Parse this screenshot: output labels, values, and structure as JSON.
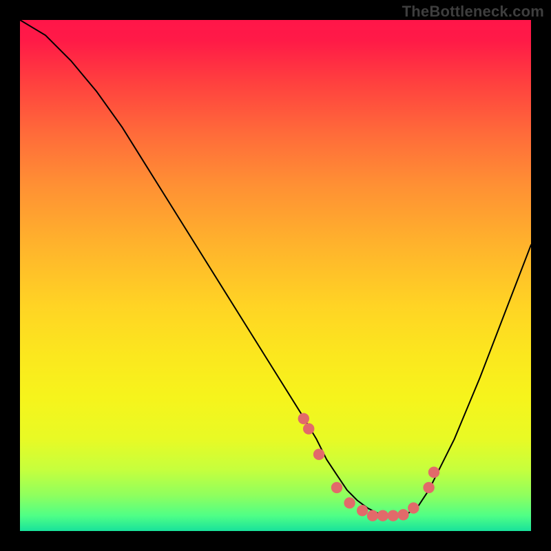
{
  "watermark": "TheBottleneck.com",
  "chart_data": {
    "type": "line",
    "title": "",
    "xlabel": "",
    "ylabel": "",
    "xlim": [
      0,
      100
    ],
    "ylim": [
      0,
      100
    ],
    "grid": false,
    "series": [
      {
        "name": "bottleneck-curve",
        "x": [
          0,
          5,
          10,
          15,
          20,
          25,
          30,
          35,
          40,
          45,
          50,
          55,
          58,
          60,
          62,
          64,
          66,
          68,
          70,
          72,
          74,
          76,
          78,
          80,
          85,
          90,
          95,
          100
        ],
        "y": [
          100,
          97,
          92,
          86,
          79,
          71,
          63,
          55,
          47,
          39,
          31,
          23,
          18,
          14,
          11,
          8,
          6,
          4.5,
          3.5,
          3,
          3,
          3.5,
          5,
          8,
          18,
          30,
          43,
          56
        ]
      }
    ],
    "markers": {
      "name": "highlight-dots",
      "color": "#e26a6a",
      "radius_pct": 1.1,
      "x": [
        55.5,
        56.5,
        58.5,
        62,
        64.5,
        67,
        69,
        71,
        73,
        75,
        77,
        80,
        81
      ],
      "y": [
        22,
        20,
        15,
        8.5,
        5.5,
        4,
        3,
        3,
        3,
        3.2,
        4.5,
        8.5,
        11.5
      ]
    }
  }
}
